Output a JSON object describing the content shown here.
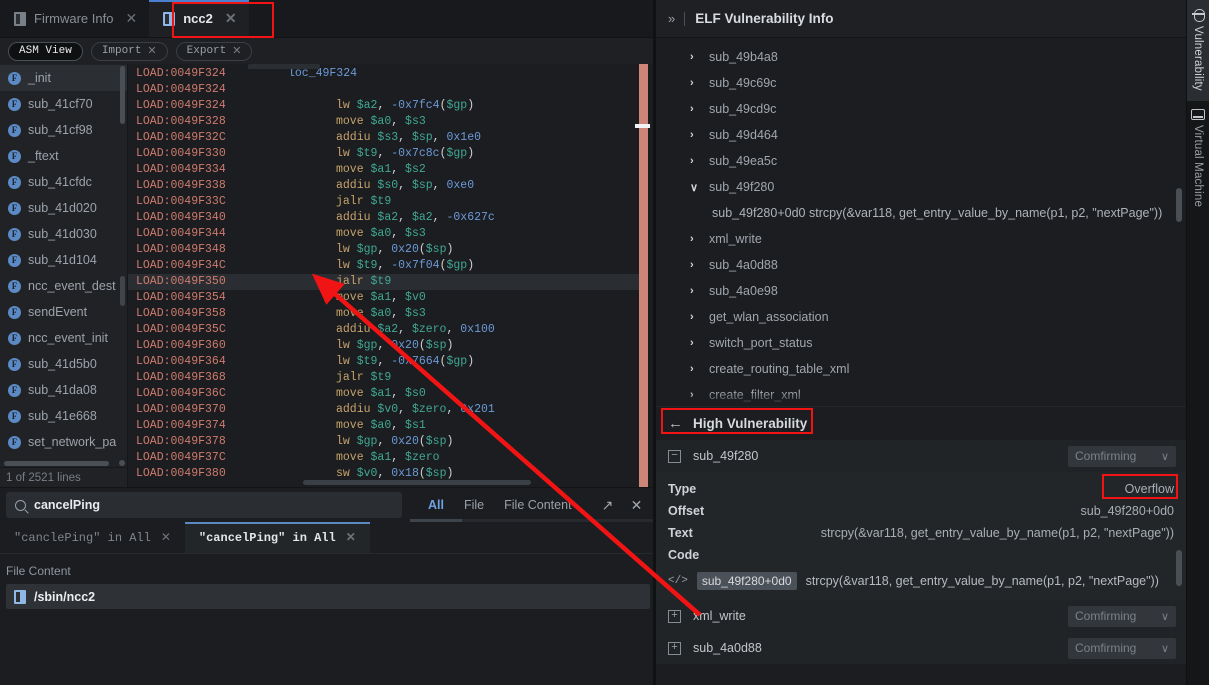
{
  "window": {
    "tabs": [
      {
        "label": "Firmware Info",
        "icon": "firmware-icon",
        "active": false,
        "closable": true
      },
      {
        "label": "ncc2",
        "icon": "binary-file-icon",
        "active": true,
        "closable": true
      }
    ]
  },
  "toolbar": {
    "buttons": [
      {
        "label": "ASM View",
        "active": true,
        "closable": false
      },
      {
        "label": "Import",
        "active": false,
        "closable": true
      },
      {
        "label": "Export",
        "active": false,
        "closable": true
      }
    ]
  },
  "function_list": {
    "items": [
      {
        "name": "_init",
        "selected": true
      },
      {
        "name": "sub_41cf70",
        "selected": false
      },
      {
        "name": "sub_41cf98",
        "selected": false
      },
      {
        "name": "_ftext",
        "selected": false
      },
      {
        "name": "sub_41cfdc",
        "selected": false
      },
      {
        "name": "sub_41d020",
        "selected": false
      },
      {
        "name": "sub_41d030",
        "selected": false
      },
      {
        "name": "sub_41d104",
        "selected": false
      },
      {
        "name": "ncc_event_dest",
        "selected": false
      },
      {
        "name": "sendEvent",
        "selected": false
      },
      {
        "name": "ncc_event_init",
        "selected": false
      },
      {
        "name": "sub_41d5b0",
        "selected": false
      },
      {
        "name": "sub_41da08",
        "selected": false
      },
      {
        "name": "sub_41e668",
        "selected": false
      },
      {
        "name": "set_network_pa",
        "selected": false
      }
    ],
    "status": "1 of 2521 lines"
  },
  "disassembly": {
    "lines": [
      {
        "addr": "LOAD:0049F324",
        "label": "loc_49F324",
        "mnemonic": "",
        "operands": "",
        "highlight": false
      },
      {
        "addr": "LOAD:0049F324",
        "label": "",
        "mnemonic": "",
        "operands": "",
        "highlight": false
      },
      {
        "addr": "LOAD:0049F324",
        "label": "",
        "mnemonic": "lw",
        "operands": "$a2, -0x7fc4($gp)",
        "highlight": false
      },
      {
        "addr": "LOAD:0049F328",
        "label": "",
        "mnemonic": "move",
        "operands": "$a0, $s3",
        "highlight": false
      },
      {
        "addr": "LOAD:0049F32C",
        "label": "",
        "mnemonic": "addiu",
        "operands": "$s3, $sp, 0x1e0",
        "highlight": false
      },
      {
        "addr": "LOAD:0049F330",
        "label": "",
        "mnemonic": "lw",
        "operands": "$t9, -0x7c8c($gp)",
        "highlight": false
      },
      {
        "addr": "LOAD:0049F334",
        "label": "",
        "mnemonic": "move",
        "operands": "$a1, $s2",
        "highlight": false
      },
      {
        "addr": "LOAD:0049F338",
        "label": "",
        "mnemonic": "addiu",
        "operands": "$s0, $sp, 0xe0",
        "highlight": false
      },
      {
        "addr": "LOAD:0049F33C",
        "label": "",
        "mnemonic": "jalr",
        "operands": "$t9",
        "highlight": false
      },
      {
        "addr": "LOAD:0049F340",
        "label": "",
        "mnemonic": "addiu",
        "operands": "$a2, $a2, -0x627c",
        "highlight": false
      },
      {
        "addr": "LOAD:0049F344",
        "label": "",
        "mnemonic": "move",
        "operands": "$a0, $s3",
        "highlight": false
      },
      {
        "addr": "LOAD:0049F348",
        "label": "",
        "mnemonic": "lw",
        "operands": "$gp, 0x20($sp)",
        "highlight": false
      },
      {
        "addr": "LOAD:0049F34C",
        "label": "",
        "mnemonic": "lw",
        "operands": "$t9, -0x7f04($gp)",
        "highlight": false
      },
      {
        "addr": "LOAD:0049F350",
        "label": "",
        "mnemonic": "jalr",
        "operands": "$t9",
        "highlight": true
      },
      {
        "addr": "LOAD:0049F354",
        "label": "",
        "mnemonic": "move",
        "operands": "$a1, $v0",
        "highlight": false
      },
      {
        "addr": "LOAD:0049F358",
        "label": "",
        "mnemonic": "move",
        "operands": "$a0, $s3",
        "highlight": false
      },
      {
        "addr": "LOAD:0049F35C",
        "label": "",
        "mnemonic": "addiu",
        "operands": "$a2, $zero, 0x100",
        "highlight": false
      },
      {
        "addr": "LOAD:0049F360",
        "label": "",
        "mnemonic": "lw",
        "operands": "$gp, 0x20($sp)",
        "highlight": false
      },
      {
        "addr": "LOAD:0049F364",
        "label": "",
        "mnemonic": "lw",
        "operands": "$t9, -0x7664($gp)",
        "highlight": false
      },
      {
        "addr": "LOAD:0049F368",
        "label": "",
        "mnemonic": "jalr",
        "operands": "$t9",
        "highlight": false
      },
      {
        "addr": "LOAD:0049F36C",
        "label": "",
        "mnemonic": "move",
        "operands": "$a1, $s0",
        "highlight": false
      },
      {
        "addr": "LOAD:0049F370",
        "label": "",
        "mnemonic": "addiu",
        "operands": "$v0, $zero, 0x201",
        "highlight": false
      },
      {
        "addr": "LOAD:0049F374",
        "label": "",
        "mnemonic": "move",
        "operands": "$a0, $s1",
        "highlight": false
      },
      {
        "addr": "LOAD:0049F378",
        "label": "",
        "mnemonic": "lw",
        "operands": "$gp, 0x20($sp)",
        "highlight": false
      },
      {
        "addr": "LOAD:0049F37C",
        "label": "",
        "mnemonic": "move",
        "operands": "$a1, $zero",
        "highlight": false
      },
      {
        "addr": "LOAD:0049F380",
        "label": "",
        "mnemonic": "sw",
        "operands": "$v0, 0x18($sp)",
        "highlight": false
      }
    ]
  },
  "search": {
    "query": "cancelPing",
    "placeholder": "Search",
    "scope_tabs": [
      {
        "label": "All",
        "active": true
      },
      {
        "label": "File",
        "active": false
      },
      {
        "label": "File Content",
        "active": false
      }
    ],
    "actions": [
      {
        "name": "expand",
        "glyph": "↗"
      },
      {
        "name": "close",
        "glyph": "✕"
      }
    ],
    "query_tabs": [
      {
        "label": "\"canclePing\" in All",
        "active": false
      },
      {
        "label": "\"cancelPing\" in All",
        "active": true
      }
    ],
    "results_section_label": "File Content",
    "results": [
      {
        "path": "/sbin/ncc2",
        "icon": "binary-file-icon",
        "selected": true
      }
    ]
  },
  "vuln_panel": {
    "header": {
      "expand_glyph": "»",
      "title": "ELF Vulnerability Info"
    },
    "tree": [
      {
        "label": "sub_49b4a8",
        "expanded": false,
        "children": []
      },
      {
        "label": "sub_49c69c",
        "expanded": false,
        "children": []
      },
      {
        "label": "sub_49cd9c",
        "expanded": false,
        "children": []
      },
      {
        "label": "sub_49d464",
        "expanded": false,
        "children": []
      },
      {
        "label": "sub_49ea5c",
        "expanded": false,
        "children": []
      },
      {
        "label": "sub_49f280",
        "expanded": true,
        "children": [
          {
            "label": "sub_49f280+0d0  strcpy(&var118, get_entry_value_by_name(p1, p2, \"nextPage\"))"
          }
        ]
      },
      {
        "label": "xml_write",
        "expanded": false,
        "children": []
      },
      {
        "label": "sub_4a0d88",
        "expanded": false,
        "children": []
      },
      {
        "label": "sub_4a0e98",
        "expanded": false,
        "children": []
      },
      {
        "label": "get_wlan_association",
        "expanded": false,
        "children": []
      },
      {
        "label": "switch_port_status",
        "expanded": false,
        "children": []
      },
      {
        "label": "create_routing_table_xml",
        "expanded": false,
        "children": []
      },
      {
        "label": "create_filter_xml",
        "expanded": false,
        "children": []
      }
    ],
    "severity_bar": {
      "back_glyph": "←",
      "title": "High Vulnerability"
    },
    "detail_groups": [
      {
        "name": "sub_49f280",
        "expanded": true,
        "status": "Comfirming",
        "fields": [
          {
            "key": "Type",
            "value": "Overflow"
          },
          {
            "key": "Offset",
            "value": "sub_49f280+0d0"
          },
          {
            "key": "Text",
            "value": "strcpy(&var118, get_entry_value_by_name(p1, p2, \"nextPage\"))"
          },
          {
            "key": "Code",
            "value": ""
          }
        ],
        "code": {
          "tag": "sub_49f280+0d0",
          "text": "strcpy(&var118, get_entry_value_by_name(p1, p2, \"nextPage\"))"
        }
      },
      {
        "name": "xml_write",
        "expanded": false,
        "status": "Comfirming",
        "fields": [],
        "code": null
      },
      {
        "name": "sub_4a0d88",
        "expanded": false,
        "status": "Comfirming",
        "fields": [],
        "code": null
      }
    ]
  },
  "rail": {
    "tabs": [
      {
        "label": "Vulnerability",
        "icon": "bug-icon",
        "active": true
      },
      {
        "label": "Virtual Machine",
        "icon": "vm-icon",
        "active": false
      }
    ]
  },
  "annotations": {
    "color": "#f11414",
    "boxes": [
      "ncc2-tab",
      "high-vulnerability-label",
      "overflow-value"
    ],
    "arrow": {
      "from": "code-tag-sub_49f280+0d0",
      "to": "asm-line-LOAD:0049F350"
    }
  },
  "colors": {
    "accent_blue": "#5b8ac4",
    "annotation_red": "#f11414",
    "addr_red": "#cf7b6e",
    "mnemonic_gold": "#c7a26a",
    "register_teal": "#41a894",
    "bg_dark": "#1b1d20"
  }
}
